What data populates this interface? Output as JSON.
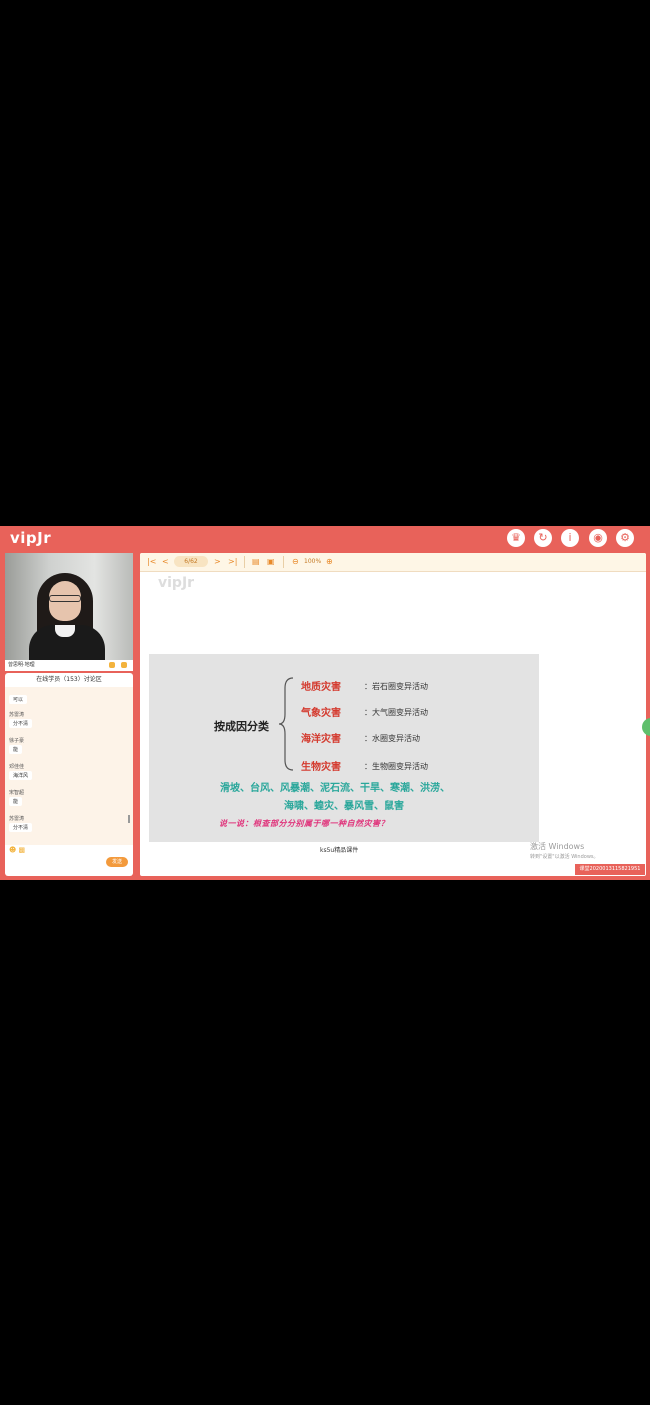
{
  "app": {
    "logo": "vipJr",
    "top_icons": [
      "trophy-icon",
      "refresh-icon",
      "info-icon",
      "eye-icon",
      "gear-icon"
    ],
    "accent_color": "#e8625a"
  },
  "video": {
    "caption_name": "曾思明·地理"
  },
  "chat": {
    "header": "在线学员（153）讨论区",
    "messages": [
      {
        "name": "",
        "text": "可以"
      },
      {
        "name": "苏雷涛",
        "text": "分不清"
      },
      {
        "name": "徐子豪",
        "text": "能"
      },
      {
        "name": "邓佳佳",
        "text": "海洋风"
      },
      {
        "name": "宋智超",
        "text": "能"
      },
      {
        "name": "苏雷涛",
        "text": "分不清"
      }
    ],
    "send_label": "发送"
  },
  "toolbar": {
    "first": "K",
    "prev": "<",
    "page": "6/62",
    "next": ">",
    "last": "K",
    "zoom": "100%"
  },
  "slide": {
    "logo": "vipJr",
    "category": "按成因分类",
    "items": [
      {
        "hazard": "地质灾害",
        "activity": "：岩石圈变异活动"
      },
      {
        "hazard": "气象灾害",
        "activity": "：大气圈变异活动"
      },
      {
        "hazard": "海洋灾害",
        "activity": "：水圈变异活动"
      },
      {
        "hazard": "生物灾害",
        "activity": "：生物圈变异活动"
      }
    ],
    "teal_line1": "滑坡、台风、风暴潮、泥石流、干旱、寒潮、洪涝、",
    "teal_line2": "海啸、蝗灾、暴风雪、鼠害",
    "prompt": "说一说：根查部分分别属于哪一种自然灾害？",
    "footer": "ks5u精品课件"
  },
  "windows_watermark": {
    "title": "激活 Windows",
    "sub": "转到\"设置\"以激活 Windows。"
  },
  "id_badge": "课堂2020013115821951"
}
